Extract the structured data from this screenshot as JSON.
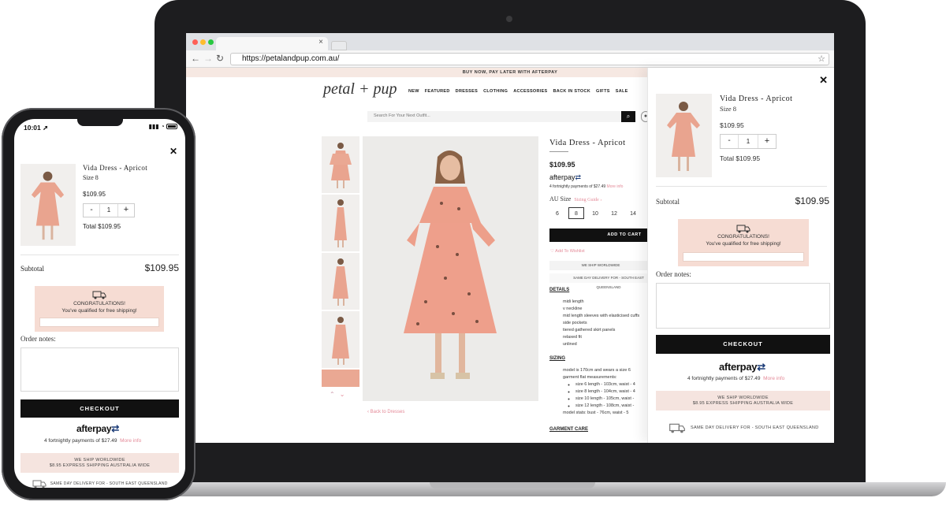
{
  "browser": {
    "url": "https://petalandpup.com.au/"
  },
  "site": {
    "promo_banner": "BUY NOW, PAY LATER WITH AFTERPAY",
    "logo": "petal + pup",
    "nav": [
      "NEW",
      "FEATURED",
      "DRESSES",
      "CLOTHING",
      "ACCESSORIES",
      "BACK IN STOCK",
      "GIFTS",
      "SALE"
    ],
    "search_placeholder": "Search For Your Next Outfit..."
  },
  "product": {
    "title": "Vida Dress - Apricot",
    "price": "$109.95",
    "afterpay_logo": "afterpay",
    "afterpay_line": "4 fortnightly payments of $27.49",
    "afterpay_more": "More info",
    "size_label": "AU Size",
    "size_guide": "Sizing Guide ›",
    "sizes": [
      "6",
      "8",
      "10",
      "12",
      "14"
    ],
    "selected_size": "8",
    "add_to_cart": "ADD TO CART",
    "wishlist": "Add To Wishlist",
    "ship_worldwide": "WE SHIP WORLDWIDE",
    "sameday": "SAME DAY DELIVERY FOR - SOUTH EAST QUEENSLAND",
    "back_link": "‹ Back to Dresses",
    "details_heading": "DETAILS",
    "details": [
      "midi length",
      "v neckline",
      "mid length sleeves with elasticised cuffs",
      "side pockets",
      "tiered gathered skirt panels",
      "relaxed fit",
      "unlined"
    ],
    "sizing_heading": "SIZING",
    "sizing": [
      {
        "text": "model is 170cm and wears a size 6",
        "sub": false
      },
      {
        "text": "garment flat measurements:",
        "sub": false
      },
      {
        "text": "size 6 length - 103cm, waist - 4",
        "sub": true
      },
      {
        "text": "size 8 length - 104cm, waist - 4",
        "sub": true
      },
      {
        "text": "size 10 length - 105cm, waist -",
        "sub": true
      },
      {
        "text": "size 12 length - 108cm, waist -",
        "sub": true
      },
      {
        "text": "model stats: bust - 76cm, waist - 5",
        "sub": false
      }
    ],
    "care_heading": "GARMENT CARE"
  },
  "cart": {
    "close": "✕",
    "item_name": "Vida Dress - Apricot",
    "item_size": "Size 8",
    "item_price": "$109.95",
    "qty_minus": "-",
    "qty_value": "1",
    "qty_plus": "+",
    "item_total": "Total $109.95",
    "subtotal_label": "Subtotal",
    "subtotal_value": "$109.95",
    "congrats_title": "CONGRATULATIONS!",
    "congrats_text": "You've qualified for free shipping!",
    "order_notes_label": "Order notes:",
    "checkout": "CHECKOUT",
    "afterpay_logo": "afterpay",
    "afterpay_line": "4 fortnightly payments of $27.49",
    "afterpay_more": "More info",
    "ship_worldwide": "WE SHIP WORLDWIDE",
    "ship_express": "$8.95 EXPRESS SHIPPING AUSTRALIA WIDE",
    "sameday": "SAME DAY DELIVERY FOR - SOUTH EAST QUEENSLAND"
  },
  "phone": {
    "time": "10:01"
  },
  "colors": {
    "accent_pink": "#e48a98",
    "congrats_bg": "#f6dcd3",
    "checkout_bg": "#111111",
    "afterpay_blue": "#1f3f7a"
  }
}
